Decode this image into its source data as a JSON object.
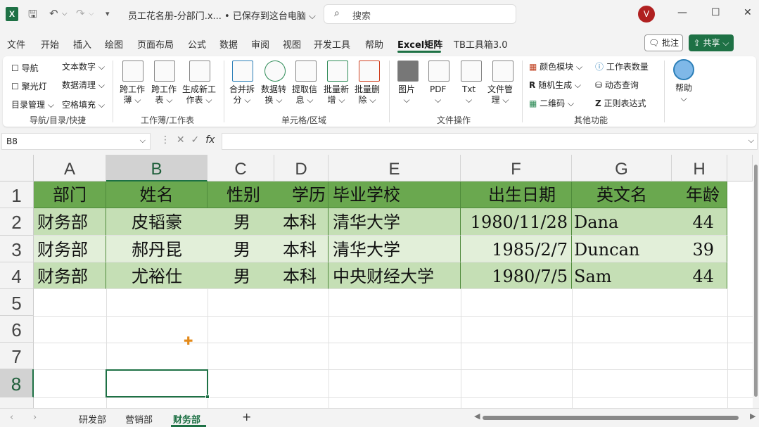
{
  "titlebar": {
    "app_logo": "X",
    "doc_title": "员工花名册-分部门.x... • 已保存到这台电脑 ⌵",
    "search_placeholder": "搜索",
    "avatar": "V"
  },
  "menu": [
    "文件",
    "开始",
    "插入",
    "绘图",
    "页面布局",
    "公式",
    "数据",
    "审阅",
    "视图",
    "开发工具",
    "帮助",
    "Excel矩阵",
    "TB工具箱3.0"
  ],
  "menu_active": "Excel矩阵",
  "comment_label": "批注",
  "share_label": "共享 ⌵",
  "ribbon": {
    "group1": {
      "items": [
        "导航",
        "文本数字 ⌵",
        "聚光灯",
        "数据清理 ⌵",
        "目录管理 ⌵",
        "空格填充 ⌵"
      ],
      "label": "导航/目录/快捷"
    },
    "group2": {
      "items": [
        "跨工作\n薄 ⌵",
        "跨工作\n表 ⌵",
        "生成新工\n作表 ⌵"
      ],
      "label": "工作薄/工作表"
    },
    "group3": {
      "items": [
        "合并拆\n分 ⌵",
        "数据转\n换 ⌵",
        "提取信\n息 ⌵",
        "批量新\n增 ⌵",
        "批量删\n除 ⌵"
      ],
      "label": "单元格/区域"
    },
    "group4": {
      "items": [
        "图片\n⌵",
        "PDF\n⌵",
        "Txt\n⌵",
        "文件管\n理 ⌵"
      ],
      "label": "文件操作"
    },
    "group5": {
      "items": [
        "颜色模块 ⌵",
        "工作表数量",
        "随机生成 ⌵",
        "动态查询",
        "二维码 ⌵",
        "正则表达式"
      ],
      "label": "其他功能"
    },
    "help": "帮助\n⌵"
  },
  "namebox": "B8",
  "columns": [
    "A",
    "B",
    "C",
    "D",
    "E",
    "F",
    "G",
    "H"
  ],
  "rows": [
    "1",
    "2",
    "3",
    "4",
    "5",
    "6",
    "7",
    "8"
  ],
  "table": {
    "headers": [
      "部门",
      "姓名",
      "性别",
      "学历",
      "毕业学校",
      "出生日期",
      "英文名",
      "年龄"
    ],
    "data": [
      [
        "财务部",
        "皮韬豪",
        "男",
        "本科",
        "清华大学",
        "1980/11/28",
        "Dana",
        "44"
      ],
      [
        "财务部",
        "郝丹昆",
        "男",
        "本科",
        "清华大学",
        "1985/2/7",
        "Duncan",
        "39"
      ],
      [
        "财务部",
        "尤裕仕",
        "男",
        "本科",
        "中央财经大学",
        "1980/7/5",
        "Sam",
        "44"
      ]
    ]
  },
  "sheets": [
    "研发部",
    "营销部",
    "财务部"
  ],
  "active_sheet": "财务部",
  "add_sheet": "+"
}
